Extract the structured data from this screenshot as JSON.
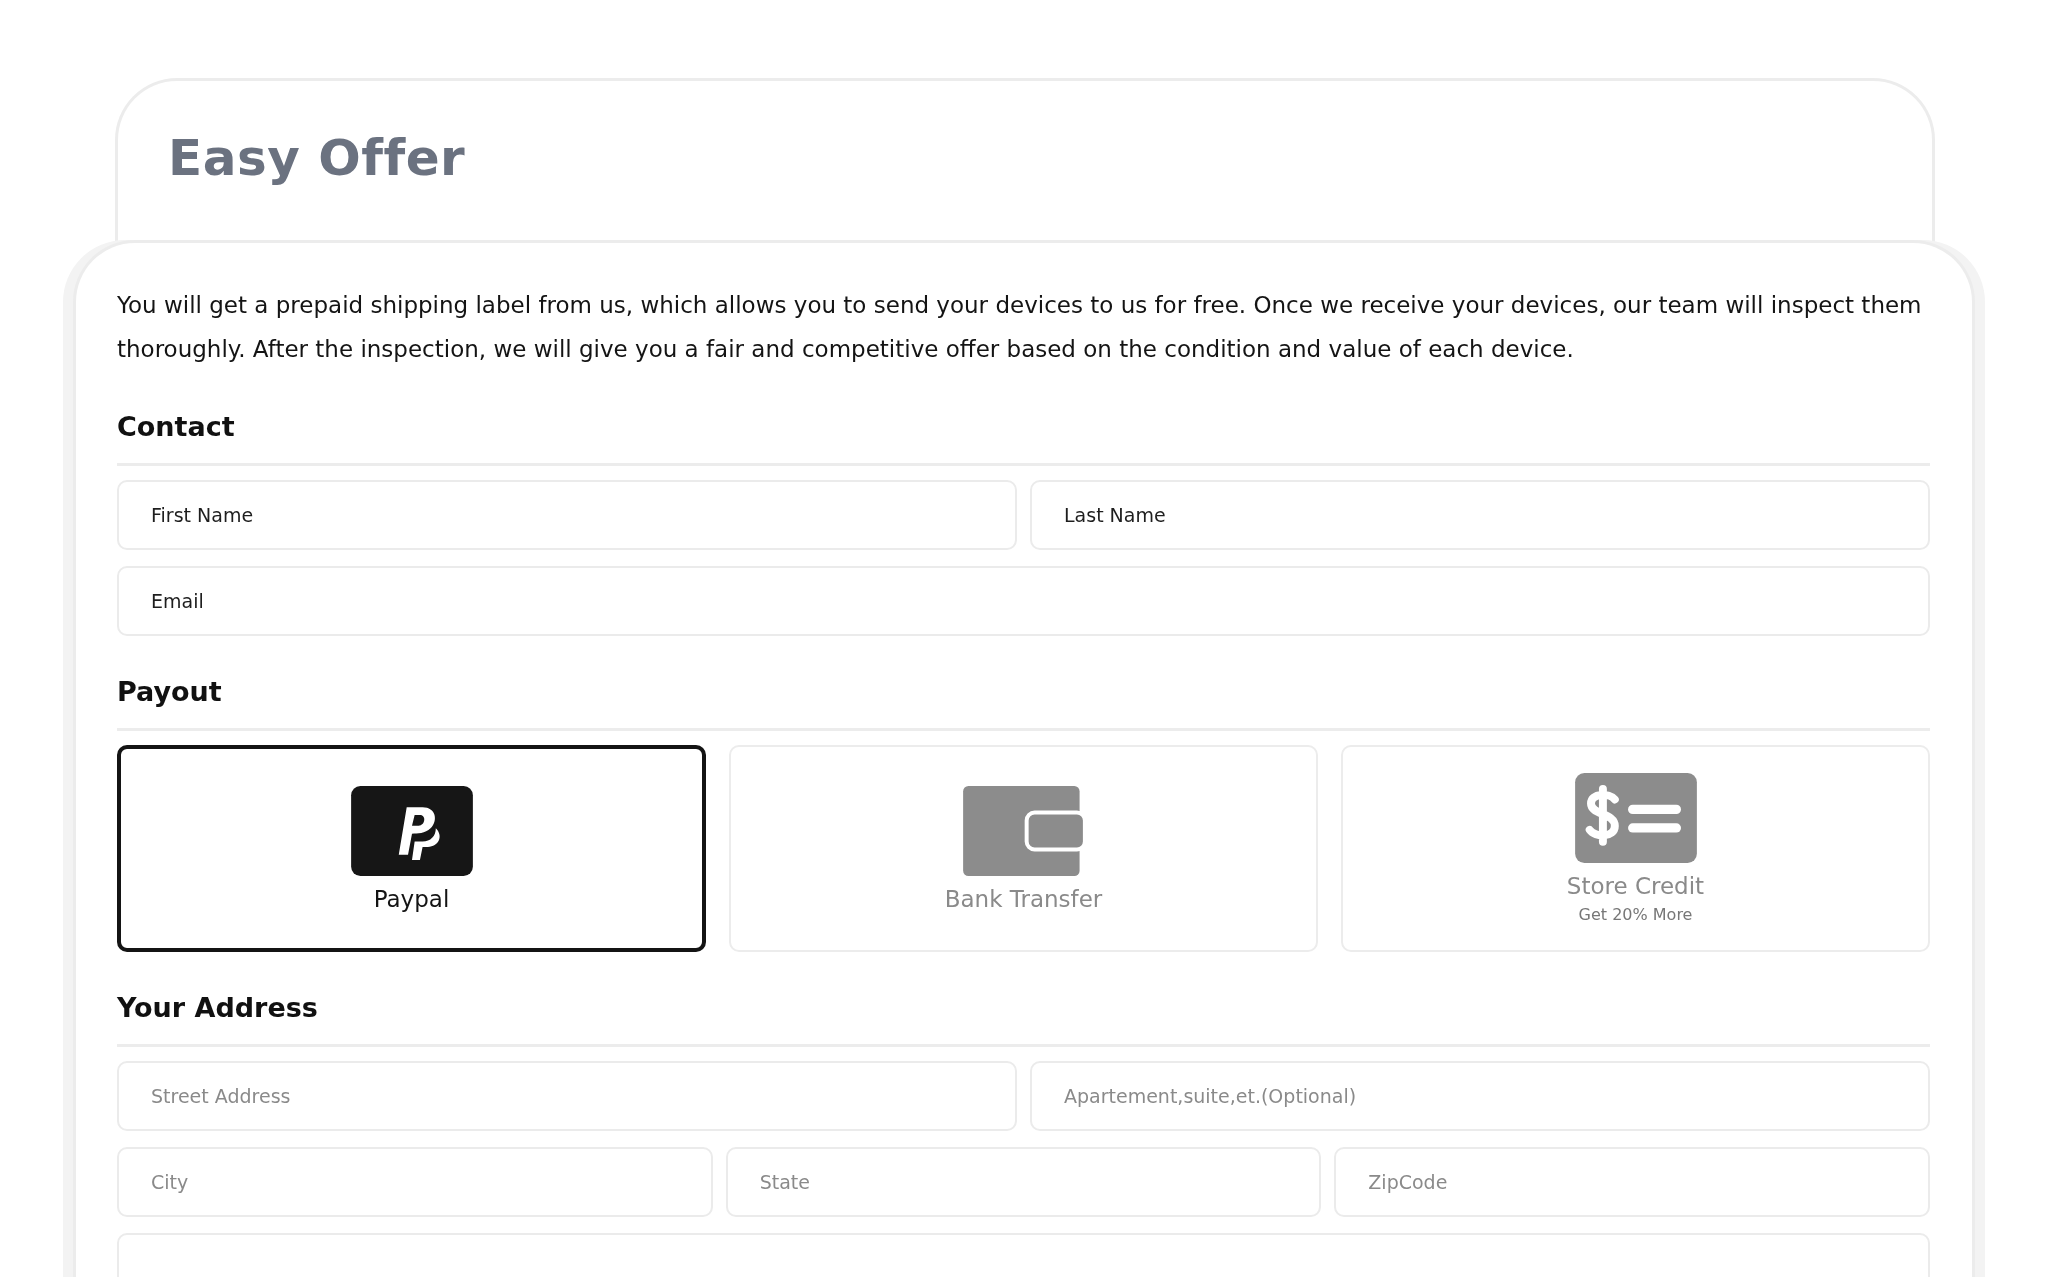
{
  "title": "Easy Offer",
  "intro": "You will get a prepaid shipping label from us, which allows you to send your devices to us for free. Once we receive your devices, our team will inspect them thoroughly. After the inspection, we will give you a fair and competitive offer based on the condition and value of each device.",
  "contact": {
    "heading": "Contact",
    "rows": [
      [
        {
          "placeholder": "First Name"
        },
        {
          "placeholder": "Last Name"
        }
      ],
      [
        {
          "placeholder": "Email"
        }
      ]
    ]
  },
  "payout": {
    "heading": "Payout",
    "options": [
      {
        "kind": "paypal",
        "label": "Paypal",
        "selected": true
      },
      {
        "kind": "wallet",
        "label": "Bank Transfer",
        "selected": false
      },
      {
        "kind": "credit",
        "label": "Store Credit",
        "note": "Get 20% More",
        "selected": false
      }
    ]
  },
  "address": {
    "heading": "Your Address",
    "rows": [
      [
        {
          "placeholder": "Street Address"
        },
        {
          "placeholder": "Apartement,suite,et.(Optional)"
        }
      ],
      [
        {
          "placeholder": "City"
        },
        {
          "placeholder": "State"
        },
        {
          "placeholder": "ZipCode"
        }
      ],
      [
        {}
      ]
    ]
  }
}
